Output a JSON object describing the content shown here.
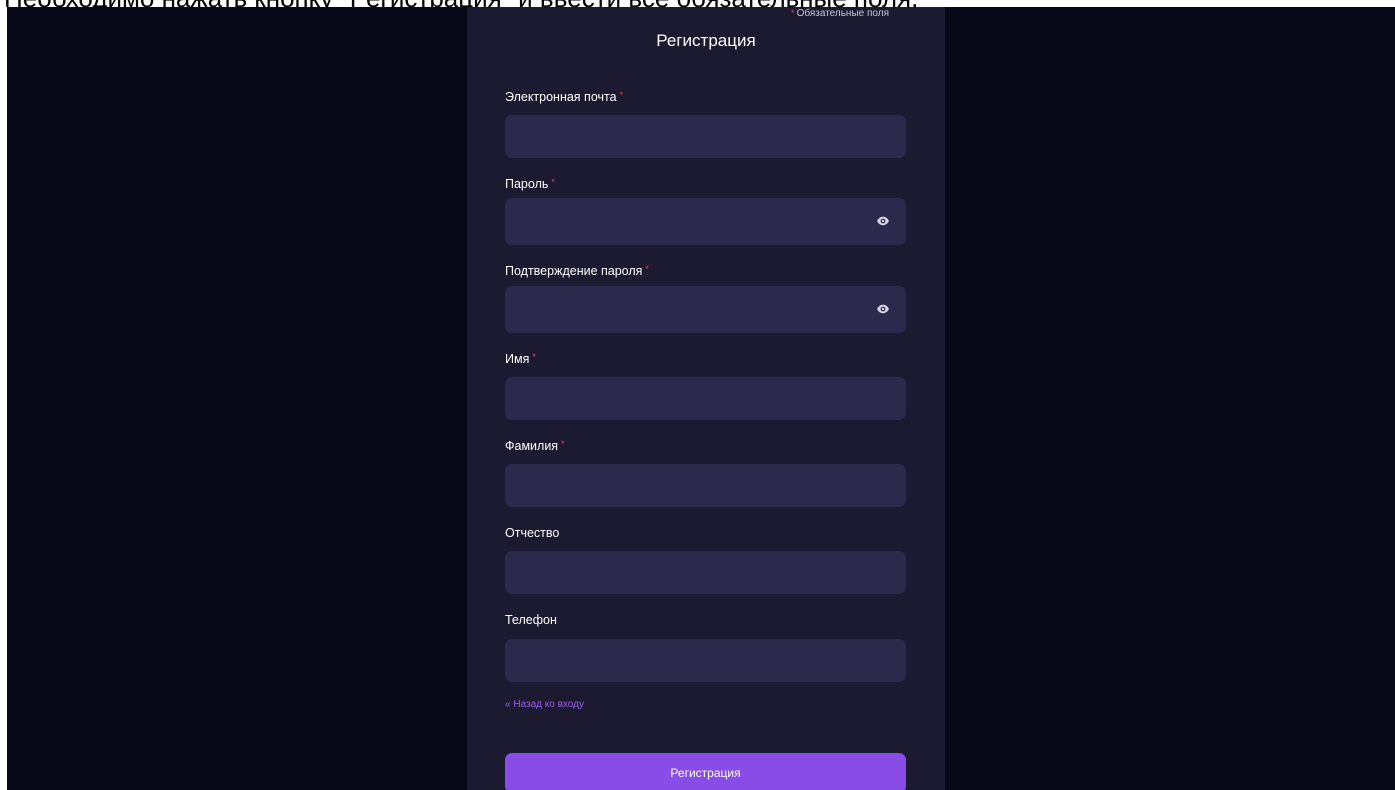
{
  "caption": "Необходимо нажать кнопку \"Регистрация\" и ввести все обязательные поля.",
  "form": {
    "required_mark": "*",
    "required_note": "Обязательные поля",
    "title": "Регистрация",
    "fields": [
      {
        "label": "Электронная почта",
        "required": "*",
        "value": "",
        "placeholder": ""
      },
      {
        "label": "Пароль",
        "required": "*",
        "value": "",
        "placeholder": "",
        "icon": "eye-icon"
      },
      {
        "label": "Подтверждение пароля",
        "required": "*",
        "value": "",
        "placeholder": "",
        "icon": "eye-icon"
      },
      {
        "label": "Имя",
        "required": "*",
        "value": "",
        "placeholder": ""
      },
      {
        "label": "Фамилия",
        "required": "*",
        "value": "",
        "placeholder": ""
      },
      {
        "label": "Отчество",
        "value": "",
        "placeholder": ""
      },
      {
        "label": "Телефон",
        "value": "",
        "placeholder": ""
      }
    ],
    "back_link": "« Назад ко входу",
    "submit_label": "Регистрация"
  },
  "colors": {
    "background": "#090816",
    "panel": "#1b1a30",
    "input": "#2b2a4d",
    "required": "#e0465a",
    "accent": "#8a4ce6",
    "link": "#9a5cf0"
  }
}
